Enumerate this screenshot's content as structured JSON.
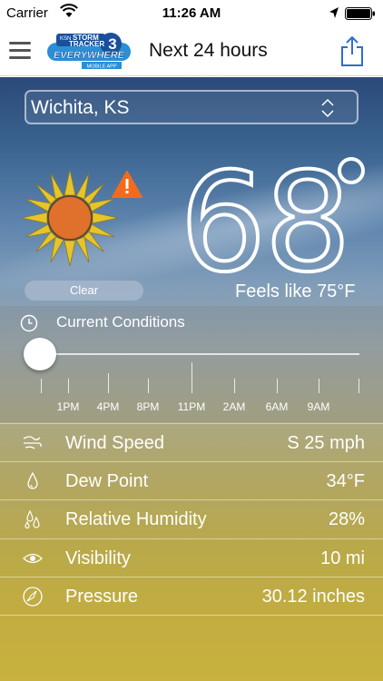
{
  "status_bar": {
    "carrier": "Carrier",
    "time": "11:26 AM"
  },
  "nav": {
    "title": "Next 24 hours",
    "logo_lines": [
      "KSN",
      "STORM",
      "TRACKER",
      "3",
      "EVERYWHERE",
      "MOBILE APP"
    ]
  },
  "location": {
    "value": "Wichita, KS"
  },
  "current": {
    "condition": "Clear",
    "temperature": "68",
    "feels_like": "Feels like  75°F",
    "section_label": "Current Conditions",
    "slider_position": 0
  },
  "timeline": {
    "labels": [
      "1PM",
      "4PM",
      "8PM",
      "11PM",
      "2AM",
      "6AM",
      "9AM"
    ]
  },
  "details": [
    {
      "label": "Wind Speed",
      "value": "S 25 mph",
      "icon": "wind-icon"
    },
    {
      "label": "Dew Point",
      "value": "34°F",
      "icon": "droplet-icon"
    },
    {
      "label": "Relative Humidity",
      "value": "28%",
      "icon": "humidity-icon"
    },
    {
      "label": "Visibility",
      "value": "10 mi",
      "icon": "eye-icon"
    },
    {
      "label": "Pressure",
      "value": "30.12 inches",
      "icon": "compass-icon"
    }
  ],
  "colors": {
    "sun_rays": "#e6c42a",
    "sun_core": "#e0712c",
    "alert": "#f26a1b"
  }
}
